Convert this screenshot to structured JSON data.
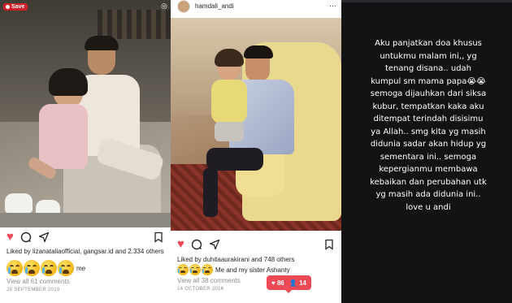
{
  "post1": {
    "save_label": "Save",
    "liked_by": "Liked by lizanataliaofficial, gangsar.id and 2.334 others",
    "caption_suffix": "me",
    "view_all": "View all 61 comments",
    "date": "25 SEPTEMBER 2019"
  },
  "post2": {
    "username": "hamdali_andi",
    "liked_by": "Liked by duhitaaurakirani and 748 others",
    "caption": "Me and my sister Ashanty",
    "view_all": "View all 38 comments",
    "date": "14 OCTOBER 2016",
    "notif_likes": "86",
    "notif_followers": "14"
  },
  "story": {
    "text": "Aku panjatkan doa khusus untukmu malam ini,, yg tenang disana.. udah kumpul sm mama papa😭😭 semoga dijauhkan dari siksa kubur, tempatkan kaka aku ditempat terindah disisimu ya Allah.. smg kita yg masih didunia sadar akan hidup yg sementara ini.. semoga kepergianmu membawa kebaikan dan perubahan utk yg masih ada didunia ini.. love u andi"
  },
  "colors": {
    "heart": "#ed4956",
    "save": "#d0202a",
    "story_bg": "#121315"
  }
}
